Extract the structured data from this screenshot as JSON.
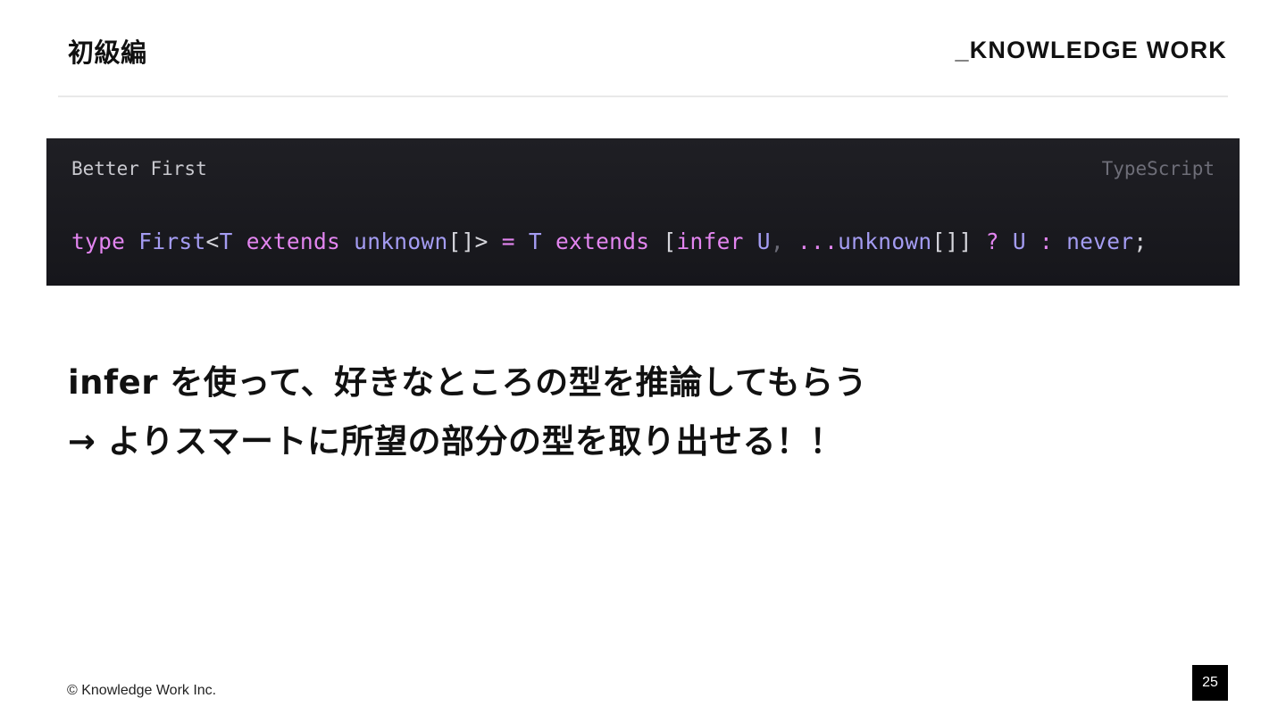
{
  "header": {
    "title": "初級編",
    "brand": "_KNOWLEDGE WORK"
  },
  "code_block": {
    "caption": "Better First",
    "language": "TypeScript",
    "tokens": [
      {
        "text": "type",
        "kind": "kw"
      },
      {
        "text": " ",
        "kind": "punc"
      },
      {
        "text": "First",
        "kind": "type"
      },
      {
        "text": "<",
        "kind": "punc"
      },
      {
        "text": "T",
        "kind": "type"
      },
      {
        "text": " ",
        "kind": "punc"
      },
      {
        "text": "extends",
        "kind": "kw"
      },
      {
        "text": " ",
        "kind": "punc"
      },
      {
        "text": "unknown",
        "kind": "type"
      },
      {
        "text": "[]>",
        "kind": "punc"
      },
      {
        "text": " ",
        "kind": "punc"
      },
      {
        "text": "=",
        "kind": "op"
      },
      {
        "text": " ",
        "kind": "punc"
      },
      {
        "text": "T",
        "kind": "type"
      },
      {
        "text": " ",
        "kind": "punc"
      },
      {
        "text": "extends",
        "kind": "kw"
      },
      {
        "text": " ",
        "kind": "punc"
      },
      {
        "text": "[",
        "kind": "punc"
      },
      {
        "text": "infer",
        "kind": "kw"
      },
      {
        "text": " ",
        "kind": "punc"
      },
      {
        "text": "U",
        "kind": "type"
      },
      {
        "text": ",",
        "kind": "dim"
      },
      {
        "text": " ",
        "kind": "punc"
      },
      {
        "text": "...",
        "kind": "kw"
      },
      {
        "text": "unknown",
        "kind": "type"
      },
      {
        "text": "[]]",
        "kind": "punc"
      },
      {
        "text": " ",
        "kind": "punc"
      },
      {
        "text": "?",
        "kind": "op"
      },
      {
        "text": " ",
        "kind": "punc"
      },
      {
        "text": "U",
        "kind": "type"
      },
      {
        "text": " ",
        "kind": "punc"
      },
      {
        "text": ":",
        "kind": "op"
      },
      {
        "text": " ",
        "kind": "punc"
      },
      {
        "text": "never",
        "kind": "type"
      },
      {
        "text": ";",
        "kind": "punc"
      }
    ]
  },
  "body": {
    "line1": "infer を使って、好きなところの型を推論してもらう",
    "line2": "→ よりスマートに所望の部分の型を取り出せる！！"
  },
  "footer": {
    "copyright": "© Knowledge Work Inc.",
    "page_number": "25"
  },
  "colors": {
    "keyword": "#e385f0",
    "type": "#a49cf2",
    "code_background": "#1b1b20"
  }
}
